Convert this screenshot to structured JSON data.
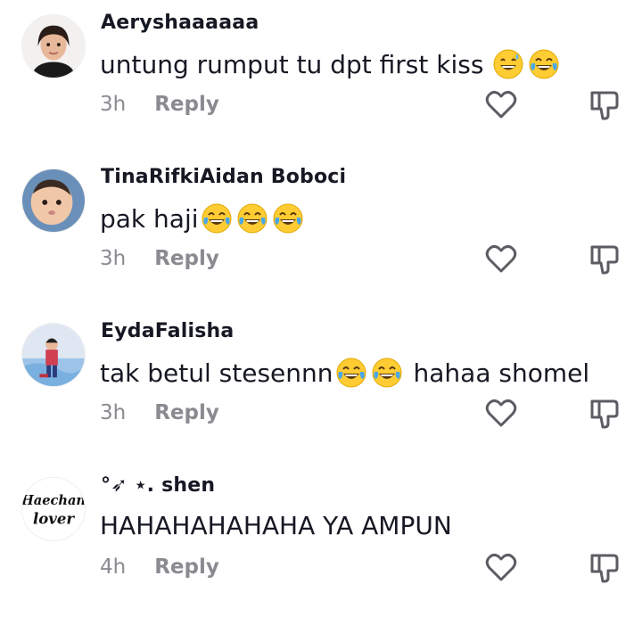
{
  "comments": [
    {
      "username": "Aeryshaaaaaa",
      "text": "untung rumput tu dpt first kiss",
      "emojis": [
        "sweat-smile-emoji",
        "tears-of-joy-emoji"
      ],
      "time": "3h",
      "reply_label": "Reply",
      "avatar": "avatar-girl-photo"
    },
    {
      "username": "TinaRifkiAidan Boboci",
      "text": "pak haji",
      "emojis": [
        "tears-of-joy-emoji",
        "tears-of-joy-emoji",
        "tears-of-joy-emoji"
      ],
      "time": "3h",
      "reply_label": "Reply",
      "avatar": "avatar-baby-photo"
    },
    {
      "username": "EydaFalisha",
      "text": "tak betul stesennn",
      "text_after": "hahaa shomel",
      "emojis": [
        "tears-of-joy-emoji",
        "tears-of-joy-emoji"
      ],
      "time": "3h",
      "reply_label": "Reply",
      "avatar": "avatar-child-photo"
    },
    {
      "username": "°➶ ⋆. shen",
      "text": "HAHAHAHAHAHA YA AMPUN",
      "emojis": [],
      "time": "4h",
      "reply_label": "Reply",
      "avatar": "avatar-text-logo",
      "avatar_text": {
        "line1": "Haechan",
        "line2": "lover"
      }
    }
  ],
  "icons": {
    "like": "heart-outline-icon",
    "dislike": "thumbs-down-outline-icon"
  },
  "colors": {
    "text": "#161823",
    "meta": "#8a8b91",
    "icon": "#5c5d63"
  }
}
